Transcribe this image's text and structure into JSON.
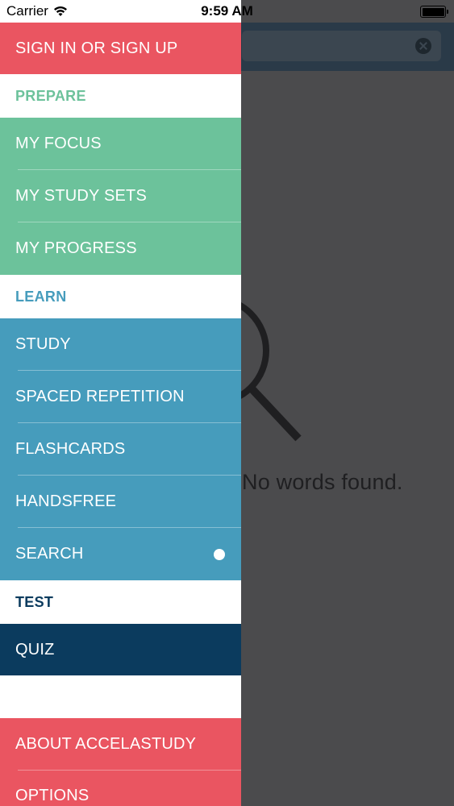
{
  "status_bar": {
    "carrier": "Carrier",
    "time": "9:59 AM"
  },
  "background": {
    "empty_message": "No words found."
  },
  "drawer": {
    "sign_in": "SIGN IN OR SIGN UP",
    "prepare": {
      "header": "PREPARE",
      "items": [
        "MY FOCUS",
        "MY STUDY SETS",
        "MY PROGRESS"
      ]
    },
    "learn": {
      "header": "LEARN",
      "items": [
        "STUDY",
        "SPACED REPETITION",
        "FLASHCARDS",
        "HANDSFREE",
        "SEARCH"
      ]
    },
    "test": {
      "header": "TEST",
      "items": [
        "QUIZ"
      ]
    },
    "footer": {
      "items": [
        "ABOUT ACCELASTUDY",
        "OPTIONS"
      ]
    }
  },
  "colors": {
    "red": "#ea5561",
    "green": "#6cc29b",
    "blue": "#469cbc",
    "navy": "#0b3b5e"
  }
}
